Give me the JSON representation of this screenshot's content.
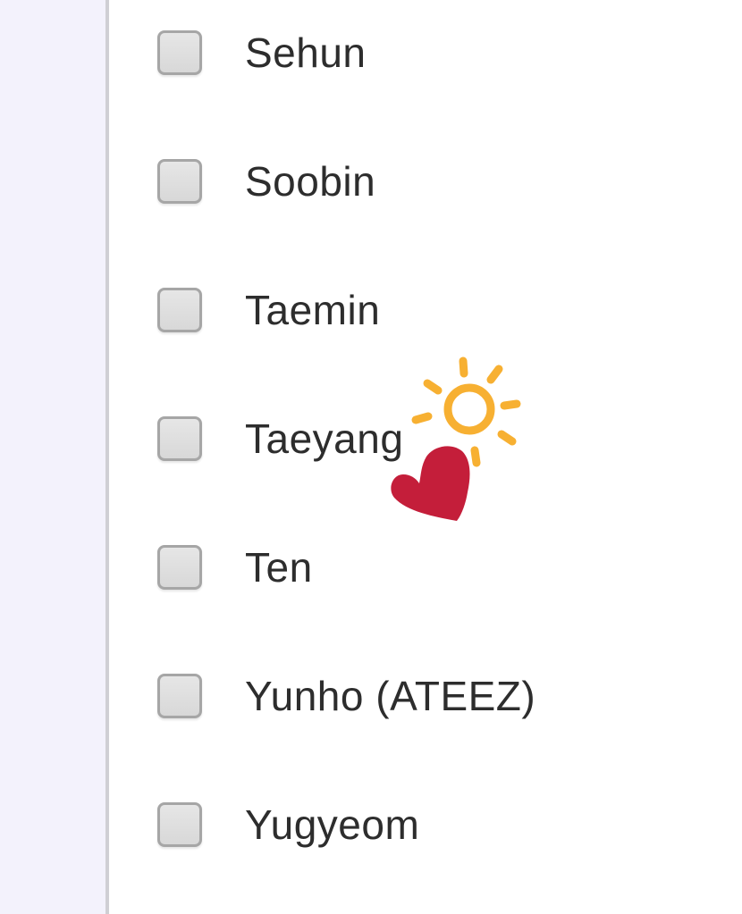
{
  "options": [
    {
      "label": "Sehun"
    },
    {
      "label": "Soobin"
    },
    {
      "label": "Taemin"
    },
    {
      "label": "Taeyang"
    },
    {
      "label": "Ten"
    },
    {
      "label": "Yunho (ATEEZ)"
    },
    {
      "label": "Yugyeom"
    }
  ],
  "stickers": {
    "sun": {
      "icon": "sun-icon",
      "color": "#f7b032"
    },
    "heart": {
      "icon": "heart-icon",
      "color": "#c41e3a"
    }
  },
  "colors": {
    "sidebar": "#f3f2fc",
    "divider": "#cfcfd4",
    "checkbox_fill": "#dedede",
    "checkbox_border": "#a6a6a6",
    "text": "#2d2d2d"
  }
}
